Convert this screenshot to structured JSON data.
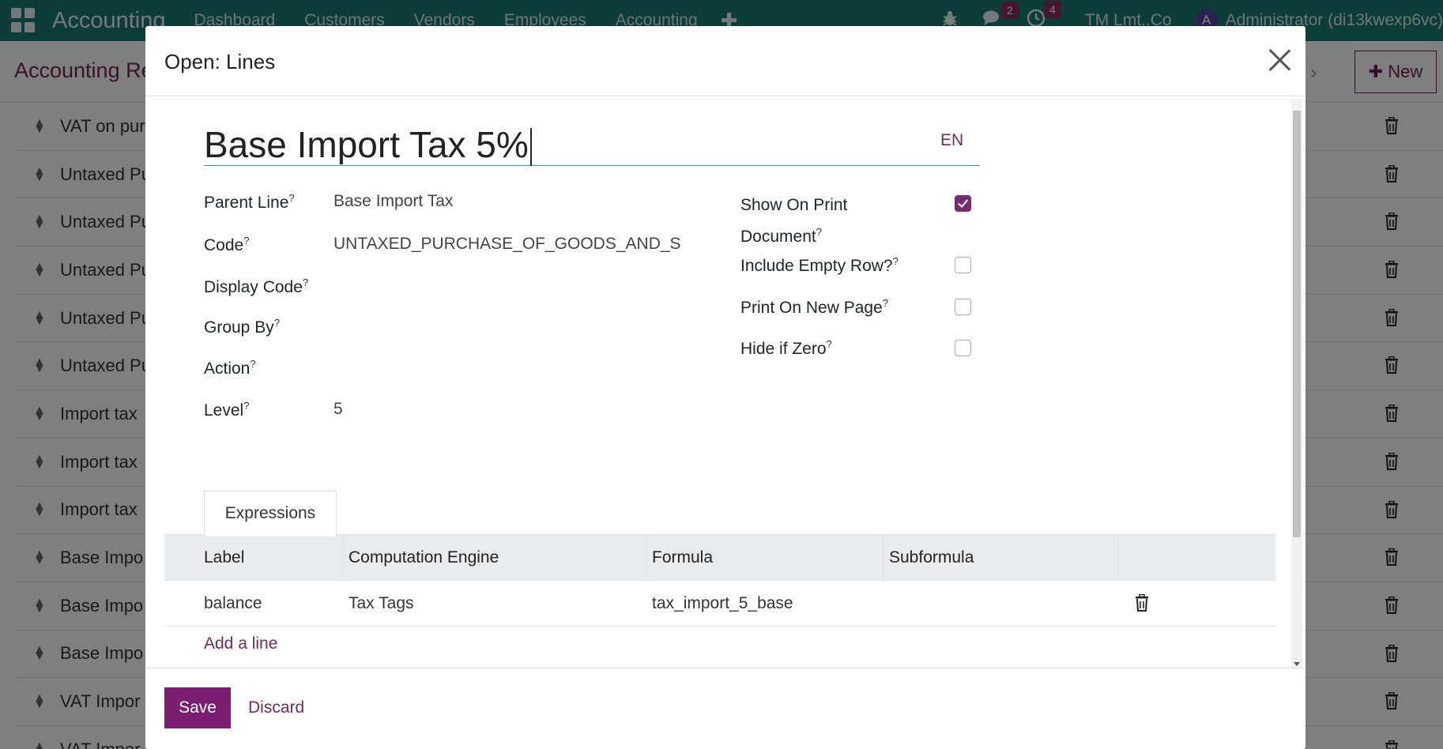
{
  "navbar": {
    "brand": "Accounting",
    "menu": [
      "Dashboard",
      "Customers",
      "Vendors",
      "Employees",
      "Accounting"
    ],
    "chat_count": "2",
    "activity_count": "4",
    "company": "TM Lmt,.Co",
    "avatar_letter": "A",
    "user": "Administrator (di13kwexp6vc)"
  },
  "control_panel": {
    "breadcrumb": "Accounting Re",
    "new_label": "New"
  },
  "background_rows": [
    "VAT on pur",
    "Untaxed Pu",
    "Untaxed Pu",
    "Untaxed Pu",
    "Untaxed Pu",
    "Untaxed Pu",
    "Import tax",
    "Import tax",
    "Import tax",
    "Base Impo",
    "Base Impo",
    "Base Impo",
    "VAT Impor",
    "VAT Impor"
  ],
  "modal": {
    "title": "Open: Lines",
    "name_value": "Base Import Tax 5%",
    "lang": "EN",
    "fields": {
      "parent_line_label": "Parent Line",
      "parent_line_value": "Base Import Tax",
      "code_label": "Code",
      "code_value": "UNTAXED_PURCHASE_OF_GOODS_AND_S",
      "display_code_label": "Display Code",
      "group_by_label": "Group By",
      "action_label": "Action",
      "level_label": "Level",
      "level_value": "5",
      "show_on_print_label_1": "Show On Print",
      "show_on_print_label_2": "Document",
      "show_on_print_checked": true,
      "include_empty_row_label": "Include Empty Row?",
      "include_empty_row_checked": false,
      "print_on_new_page_label": "Print On New Page",
      "print_on_new_page_checked": false,
      "hide_if_zero_label": "Hide if Zero",
      "hide_if_zero_checked": false,
      "help_mark": "?"
    },
    "tab_label": "Expressions",
    "table": {
      "headers": [
        "Label",
        "Computation Engine",
        "Formula",
        "Subformula"
      ],
      "rows": [
        {
          "label": "balance",
          "engine": "Tax Tags",
          "formula": "tax_import_5_base",
          "subformula": ""
        }
      ],
      "add_line": "Add a line"
    },
    "save_label": "Save",
    "discard_label": "Discard"
  },
  "colors": {
    "navbar": "#1a7a73",
    "primary": "#7b1e72",
    "link": "#71295f"
  }
}
